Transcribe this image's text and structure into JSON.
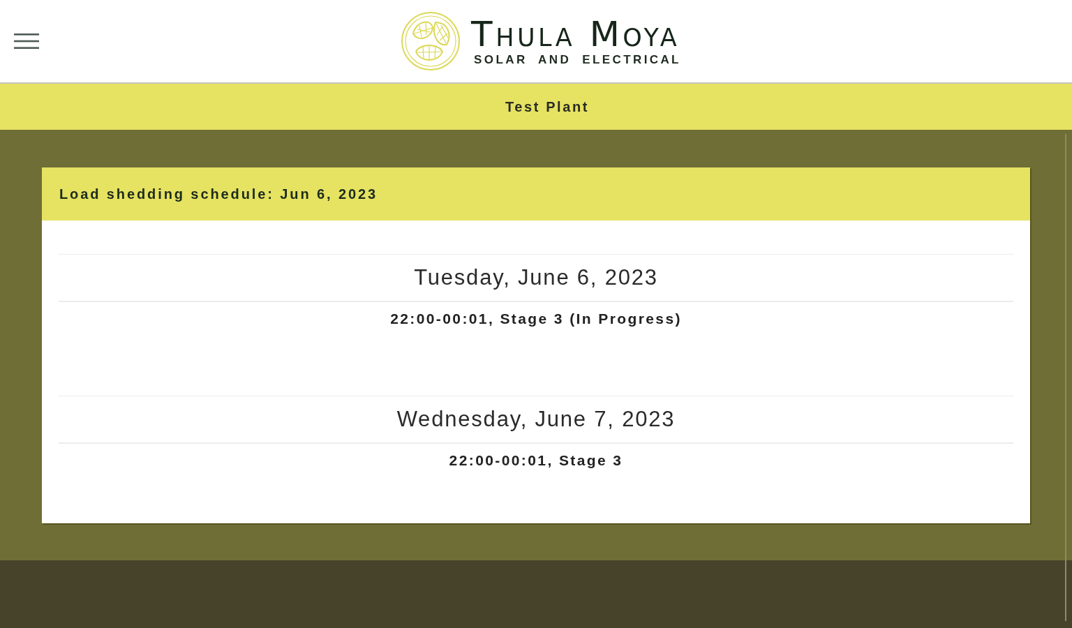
{
  "header": {
    "logo": {
      "title": "Thula Moya",
      "subtitle": "SOLAR AND ELECTRICAL"
    }
  },
  "plant_bar": {
    "title": "Test Plant"
  },
  "schedule": {
    "title": "Load shedding schedule: Jun 6, 2023",
    "days": [
      {
        "date": "Tuesday, June 6, 2023",
        "slots": [
          "22:00-00:01, Stage 3 (In Progress)"
        ]
      },
      {
        "date": "Wednesday, June 7, 2023",
        "slots": [
          "22:00-00:01, Stage 3"
        ]
      }
    ]
  }
}
